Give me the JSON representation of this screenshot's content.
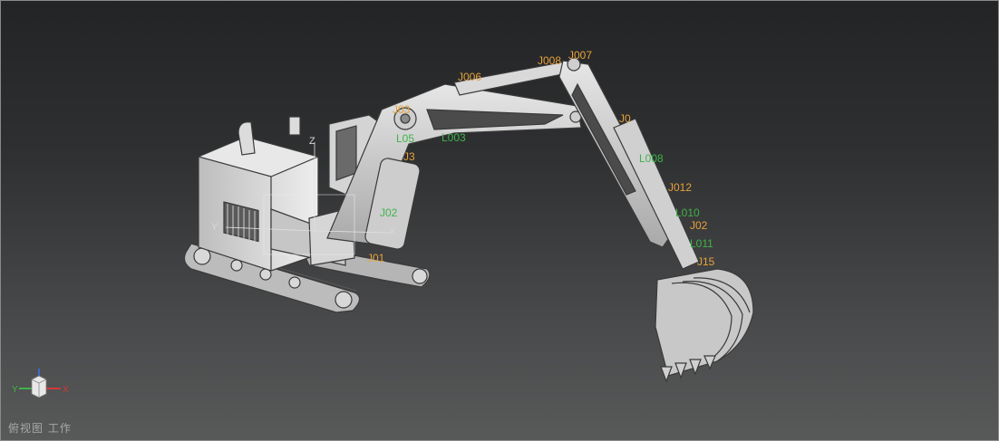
{
  "viewport": {
    "view_name": "俯视图",
    "mode": "工作"
  },
  "model_axes": {
    "x": "X",
    "y": "Y",
    "z": "Z"
  },
  "triad": {
    "x": "X",
    "y": "Y",
    "z": "Z"
  },
  "joint_labels": [
    {
      "id": "j007",
      "text": "J007"
    },
    {
      "id": "j008",
      "text": "J008"
    },
    {
      "id": "j006",
      "text": "J006"
    },
    {
      "id": "j0",
      "text": "J0"
    },
    {
      "id": "j012",
      "text": "J012"
    },
    {
      "id": "j02",
      "text": "J02"
    },
    {
      "id": "jb",
      "text": "J03"
    },
    {
      "id": "jc",
      "text": "J3"
    },
    {
      "id": "jd",
      "text": "J01"
    },
    {
      "id": "je",
      "text": "J15"
    }
  ],
  "link_labels": [
    {
      "id": "l003",
      "text": "L003"
    },
    {
      "id": "l008",
      "text": "L008"
    },
    {
      "id": "l010",
      "text": "L010"
    },
    {
      "id": "l011",
      "text": "L011"
    },
    {
      "id": "l02",
      "text": "J02"
    },
    {
      "id": "l05",
      "text": "L05"
    }
  ],
  "colors": {
    "joint": "#e6a23c",
    "link": "#3fb34a",
    "model_fill": "#cfcfcf",
    "model_edge": "#3a3a3a"
  }
}
